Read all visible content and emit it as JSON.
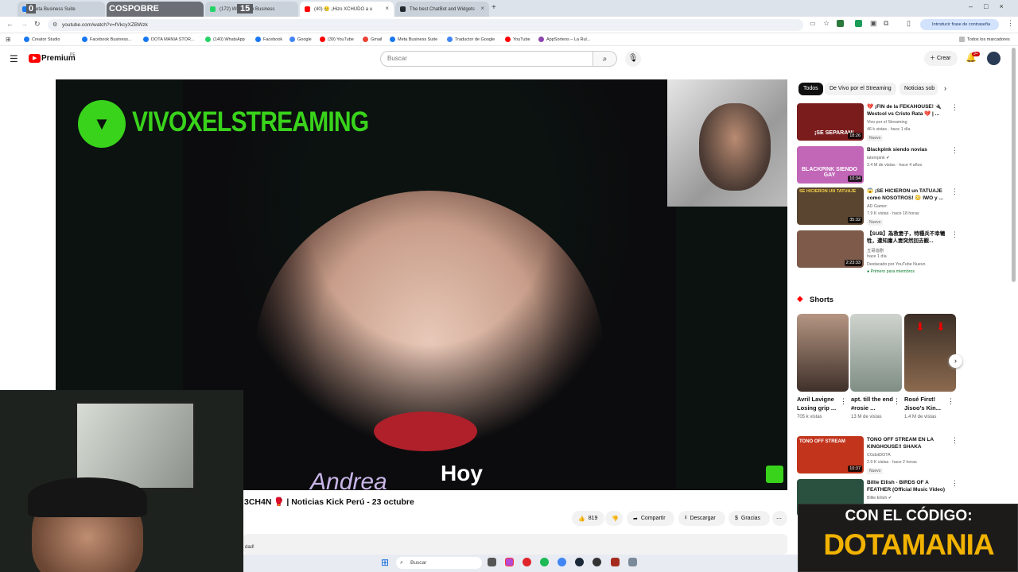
{
  "tabs": [
    {
      "label": "Meta Business Suite",
      "overlay": "0",
      "color": "#1877f2"
    },
    {
      "label": "COSPOBRE",
      "color": "#2b2b2b"
    },
    {
      "label": "(172) WhatsApp Business",
      "overlay": "15",
      "color": "#25d366"
    },
    {
      "label": "(40) 🥲 ¡Hizo XCHUDO a u",
      "color": "#ff0000"
    },
    {
      "label": "The best ChatBot and Widgets",
      "color": "#24292e"
    }
  ],
  "address": {
    "url": "youtube.com/watch?v=fVkcyXZBWzk",
    "password_prompt": "Introducir frase de contraseña"
  },
  "bookmarks": [
    {
      "label": "Creator Studio",
      "color": "#1877f2"
    },
    {
      "label": "Facebook Business...",
      "color": "#1877f2"
    },
    {
      "label": "DOTA MANIA STOR...",
      "color": "#1877f2"
    },
    {
      "label": "(140) WhatsApp",
      "color": "#25d366"
    },
    {
      "label": "Facebook",
      "color": "#1877f2"
    },
    {
      "label": "Google",
      "color": "#4285f4"
    },
    {
      "label": "(39) YouTube",
      "color": "#ff0000"
    },
    {
      "label": "Gmail",
      "color": "#ea4335"
    },
    {
      "label": "Meta Business Suite",
      "color": "#1877f2"
    },
    {
      "label": "Traductor de Google",
      "color": "#4285f4"
    },
    {
      "label": "YouTube",
      "color": "#ff0000"
    },
    {
      "label": "AppSorteos – La Rul...",
      "color": "#8e44ad"
    }
  ],
  "bookmarks_all": "Todos los marcadores",
  "yt": {
    "logo": "Premium",
    "region": "PE",
    "search_placeholder": "Buscar",
    "create": "Crear",
    "notif_count": "9+"
  },
  "video": {
    "overlay_logo_text": "VIVOXELSTREAMING",
    "caption_left": "Andrea",
    "caption_right": "Hoy",
    "title": "3CH4N 🥊 | Noticias Kick Perú - 23 octubre",
    "likes": "819",
    "share": "Compartir",
    "download": "Descargar",
    "thanks": "Gracias",
    "desc_fragment": "dad!"
  },
  "chips": [
    "Todos",
    "De Vivo por el Streaming",
    "Noticias sob"
  ],
  "recs": [
    {
      "title": "💔 ¡FIN de la FEKAHOUSE! 🔌 Westcol vs Cristo Rata 💔 | ...",
      "channel": "Vivo por el Streaming",
      "views": "46 k vistas · hace 1 día",
      "badge": "Nuevo",
      "duration": "18:26",
      "thumb_text": "¡SE SEPARAN!",
      "thumb_color": "#7a1c1c"
    },
    {
      "title": "Blackpink siendo novias",
      "channel": "latempink ✔",
      "views": "3.4 M de vistas · hace 4 años",
      "badge": "",
      "duration": "10:34",
      "thumb_text": "BLACKPINK SIENDO GAY",
      "thumb_color": "#c266b8"
    },
    {
      "title": "😱 ¡SE HICIERON un TATUAJE como NOSOTROS! 😳 IWO y ...",
      "channel": "AD Gamer",
      "views": "7.9 K vistas · hace 18 horas",
      "badge": "Nuevo",
      "duration": "35:32",
      "thumb_text": "SE HICIERON UN TATUAJE",
      "thumb_color": "#5a4530"
    },
    {
      "title": "【SUB】為救妻子，特種兵不幸犧牲，遭知庸人妻突然回去觀...",
      "channel": "五哥追剧",
      "views": "hace 1 día",
      "badge": "Destacado por YouTube  Nuevo",
      "member": "Primero para miembros",
      "duration": "2:23:33",
      "thumb_text": "",
      "thumb_color": "#7d5a4a"
    }
  ],
  "shorts_title": "Shorts",
  "shorts": [
    {
      "title": "Avril Lavigne Losing grip ...",
      "views": "705 k vistas",
      "color": "#8a6a58"
    },
    {
      "title": "apt. till the end #rosie ...",
      "views": "13 M de vistas",
      "color": "#9fa6a0"
    },
    {
      "title": "Rosé First! Jisoo's Kin...",
      "views": "1.4 M de vistas",
      "color": "#4a3a30"
    }
  ],
  "recs2": [
    {
      "title": "TONO OFF STREAM EN LA KINGHOUSE!! SHAKA CUENTA...",
      "channel": "CGdotDOTA",
      "views": "2.9 K vistas · hace 2 horas",
      "badge": "Nuevo",
      "duration": "10:37",
      "thumb_color": "#c2341c",
      "thumb_text": "TONO OFF STREAM"
    },
    {
      "title": "Billie Eilish - BIRDS OF A FEATHER (Official Music Video)",
      "channel": "Billie Eilish ✔",
      "views": "",
      "badge": "",
      "duration": "",
      "thumb_color": "#2a5040",
      "thumb_text": ""
    }
  ],
  "banner": {
    "line1": "CON EL CÓDIGO:",
    "line2": "DOTAMANIA"
  },
  "taskbar": {
    "search": "Buscar"
  }
}
